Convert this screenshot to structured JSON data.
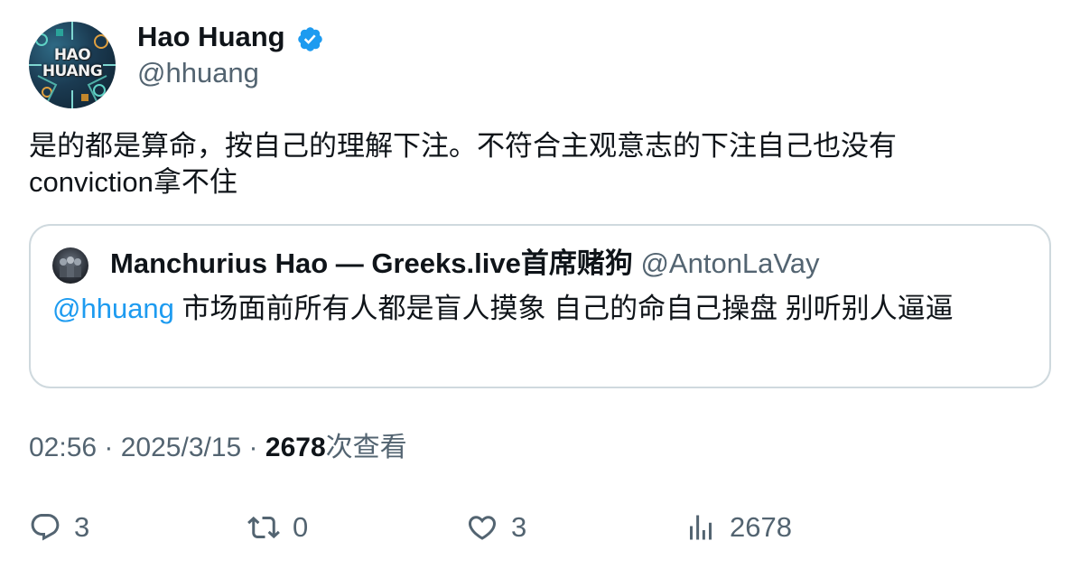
{
  "author": {
    "name": "Hao Huang",
    "handle": "@hhuang",
    "avatar_text_line1": "HAO",
    "avatar_text_line2": "HUANG",
    "verified_color": "#1d9bf0"
  },
  "tweet": {
    "text": "是的都是算命，按自己的理解下注。不符合主观意志的下注自己也没有\nconviction拿不住"
  },
  "quote": {
    "name": "Manchurius Hao — Greeks.live首席赌狗",
    "handle": "@AntonLaVay",
    "mention": "@hhuang",
    "text": " 市场面前所有人都是盲人摸象 自己的命自己操盘 别听别人逼逼"
  },
  "meta": {
    "time": "02:56",
    "sep1": " · ",
    "date": "2025/3/15",
    "sep2": " · ",
    "views_count": "2678",
    "views_label": "次查看"
  },
  "actions": {
    "replies": "3",
    "reposts": "0",
    "likes": "3",
    "views": "2678"
  },
  "colors": {
    "text": "#0f1419",
    "secondary": "#536471",
    "link": "#1d9bf0",
    "border": "#cfd9de"
  }
}
